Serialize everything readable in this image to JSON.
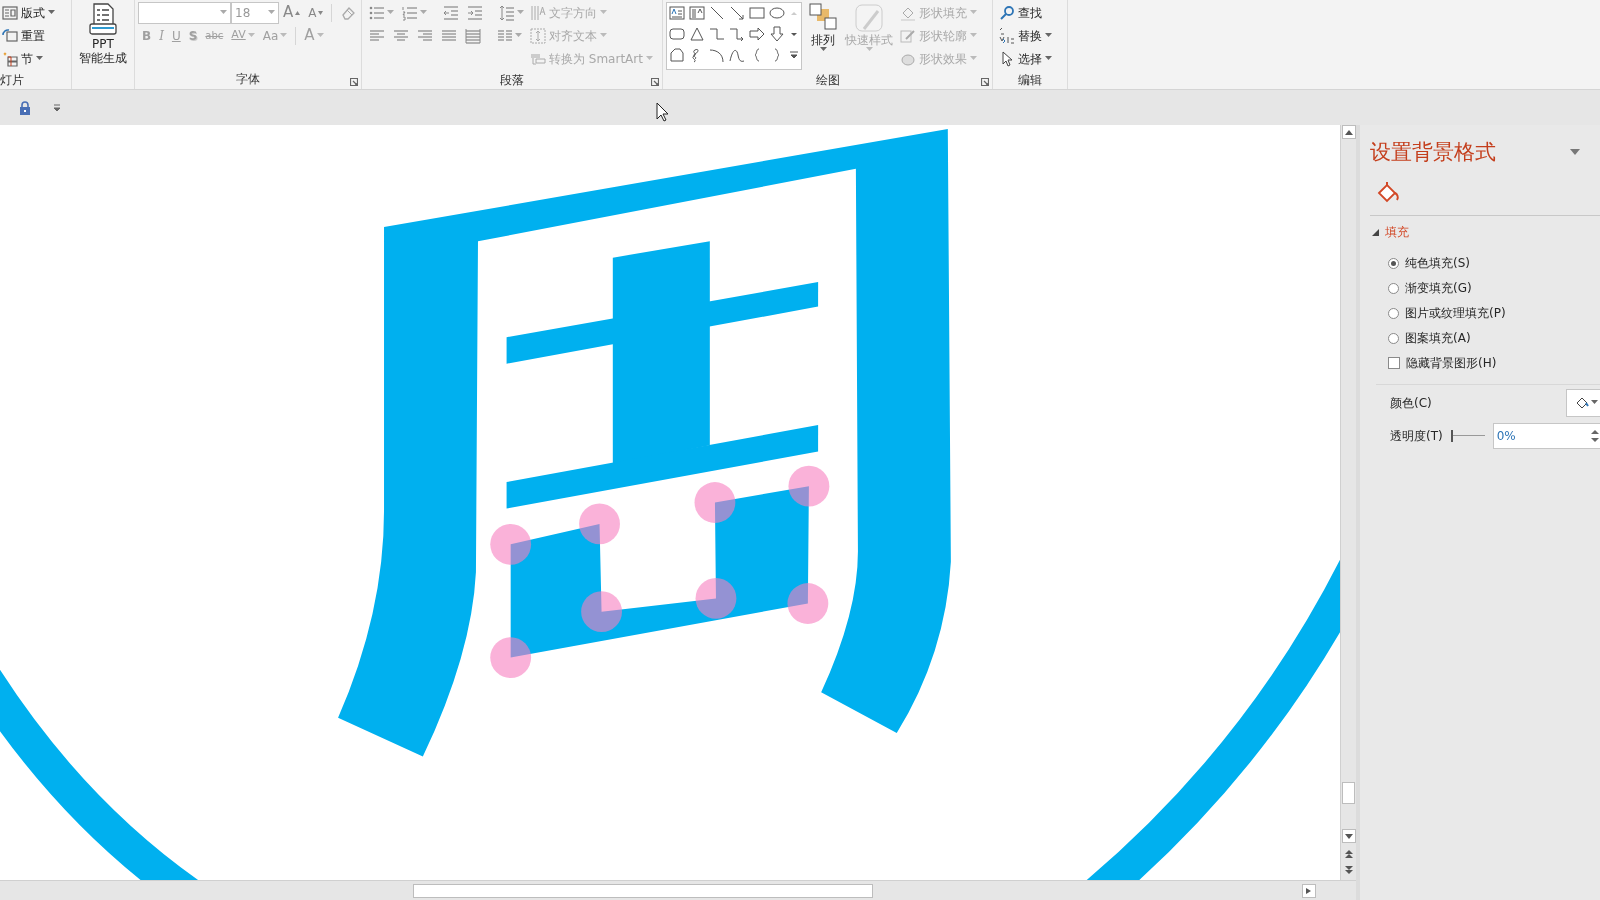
{
  "slides_group": {
    "items": [
      {
        "label": "版式",
        "dropdown": true
      },
      {
        "label": "重置",
        "dropdown": false
      },
      {
        "label": "节",
        "dropdown": true
      }
    ],
    "label": "灯片"
  },
  "smart_button": {
    "lines": [
      "PPT",
      "智能生成"
    ]
  },
  "font_group": {
    "font_size": "18",
    "size_buttons": [
      {
        "label": "A",
        "kind": "grow"
      },
      {
        "label": "A",
        "kind": "shrink"
      }
    ],
    "format_buttons": [
      {
        "label": "B",
        "dropdown": false,
        "disabled": true
      },
      {
        "label": "I",
        "dropdown": false,
        "disabled": true
      },
      {
        "label": "U",
        "dropdown": false,
        "disabled": true
      },
      {
        "label": "S",
        "dropdown": false,
        "disabled": true
      },
      {
        "label": "abc",
        "dropdown": false,
        "disabled": true
      },
      {
        "label": "AV",
        "dropdown": true,
        "disabled": true
      },
      {
        "label": "Aa",
        "dropdown": true,
        "disabled": true
      },
      {
        "label": "A",
        "dropdown": true,
        "disabled": true
      }
    ],
    "label": "字体"
  },
  "paragraph_group": {
    "text_buttons": [
      {
        "label": "文字方向",
        "disabled": true
      },
      {
        "label": "对齐文本",
        "disabled": true
      },
      {
        "label": "转换为 SmartArt",
        "disabled": true
      }
    ],
    "label": "段落"
  },
  "drawing_group": {
    "arrange": {
      "label": "排列",
      "disabled": false
    },
    "quick_styles": {
      "label": "快速样式",
      "disabled": true
    },
    "shape_buttons": [
      {
        "label": "形状填充",
        "disabled": true
      },
      {
        "label": "形状轮廓",
        "disabled": true
      },
      {
        "label": "形状效果",
        "disabled": true
      }
    ],
    "label": "绘图"
  },
  "editing_group": {
    "buttons": [
      {
        "label": "查找",
        "dropdown": false
      },
      {
        "label": "替换",
        "dropdown": true
      },
      {
        "label": "选择",
        "dropdown": true
      }
    ],
    "label": "编辑"
  },
  "format_pane": {
    "title": "设置背景格式",
    "section": {
      "label": "填充",
      "expanded": true
    },
    "fill_options": [
      {
        "label": "纯色填充(S)",
        "selected": true
      },
      {
        "label": "渐变填充(G)",
        "selected": false
      },
      {
        "label": "图片或纹理填充(P)",
        "selected": false
      },
      {
        "label": "图案填充(A)",
        "selected": false
      }
    ],
    "hide_graphics": {
      "label": "隐藏背景图形(H)",
      "checked": false
    },
    "color": {
      "label": "颜色(C)"
    },
    "transparency": {
      "label": "透明度(T)",
      "level": 0,
      "value": "0%"
    }
  }
}
